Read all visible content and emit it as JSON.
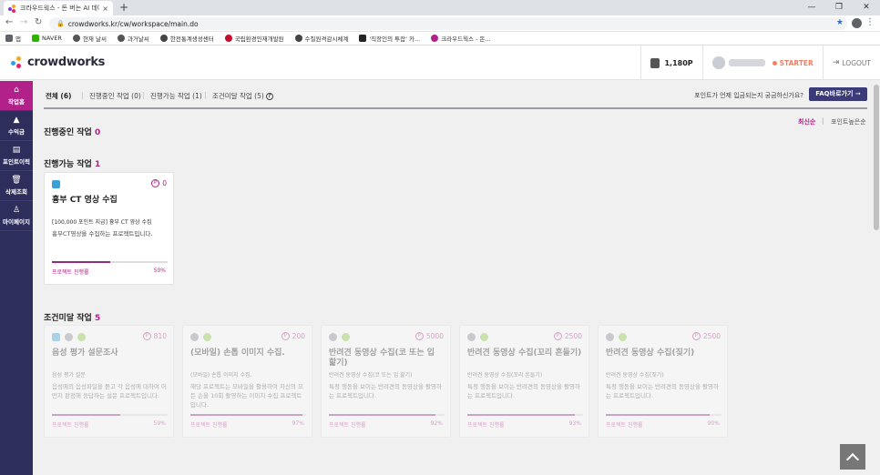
{
  "browser": {
    "tab_title": "크라우드웍스 - 돈 버는 AI 데이터",
    "tab_close": "×",
    "new_tab": "+",
    "url": "crowdworks.kr/cw/workspace/main.do",
    "window_controls": [
      "—",
      "❐",
      "✕"
    ],
    "bookmarks": [
      {
        "label": "앱",
        "icon": "apps-icon",
        "color": "#5f6368"
      },
      {
        "label": "NAVER",
        "icon": "naver-icon",
        "color": "#2db400"
      },
      {
        "label": "현재 날씨",
        "icon": "weather-icon",
        "color": "#555555"
      },
      {
        "label": "과거날씨",
        "icon": "weather-icon",
        "color": "#555555"
      },
      {
        "label": "한전통계생성센터",
        "icon": "globe-icon",
        "color": "#444444"
      },
      {
        "label": "국립환경인재개발원",
        "icon": "korea-icon",
        "color": "#c60c30"
      },
      {
        "label": "수질원격감시체계",
        "icon": "globe-icon",
        "color": "#444444"
      },
      {
        "label": "'직장인의 투잡' 카...",
        "icon": "cafe-icon",
        "color": "#222222"
      },
      {
        "label": "크라우드웍스 - 돈...",
        "icon": "crowdworks-icon",
        "color": "#b2208a"
      }
    ]
  },
  "header": {
    "logo_text": "crowdworks",
    "points": "1,180P",
    "grade": "STARTER",
    "logout": "LOGOUT"
  },
  "sidebar": {
    "items": [
      {
        "label": "작업홈",
        "icon": "home-icon",
        "glyph": "⌂",
        "active": true
      },
      {
        "label": "수익금",
        "icon": "money-icon",
        "glyph": "▲",
        "active": false
      },
      {
        "label": "포인트이력",
        "icon": "history-icon",
        "glyph": "▤",
        "active": false
      },
      {
        "label": "삭제조회",
        "icon": "trash-icon",
        "glyph": "🗑",
        "active": false
      },
      {
        "label": "마이페이지",
        "icon": "user-icon",
        "glyph": "♙",
        "active": false
      }
    ]
  },
  "filters": {
    "all": "전체 (6)",
    "in_progress": "진행중인 작업 (0)",
    "available": "진행가능 작업 (1)",
    "unmet": "조건미달 작업 (5)",
    "help_glyph": "?",
    "faq_question": "포인트가 언제 입금되는지 궁금하신가요?",
    "faq_button": "FAQ바로가기 ➞"
  },
  "sort": {
    "latest": "최신순",
    "sep": "|",
    "points": "포인트높은순"
  },
  "sections": {
    "in_progress": {
      "title": "진행중인 작업",
      "count": "0"
    },
    "available": {
      "title": "진행가능 작업",
      "count": "1"
    },
    "unmet": {
      "title": "조건미달 작업",
      "count": "5"
    }
  },
  "available_cards": [
    {
      "platforms": [
        "mon"
      ],
      "point": "0",
      "title": "흉부 CT 영상 수집",
      "subtitle": "[100,000 포인트 지급] 흉부 CT 영상 수집",
      "desc": "흉부CT영상을 수집하는 프로젝트입니다.",
      "progress_label": "프로젝트 진행률",
      "progress": 50,
      "progress_text": "50%"
    }
  ],
  "unmet_cards": [
    {
      "platforms": [
        "mon",
        "apple",
        "android"
      ],
      "point": "810",
      "title": "음성 평가 설문조사",
      "subtitle": "음성 평가 설문",
      "desc": "음성에의 음성파일을 듣고 각 음성에 대하여 어떤지 판정해 응답하는 설문 프로젝트입니다.",
      "progress_label": "프로젝트 진행률",
      "progress": 59,
      "progress_text": "59%"
    },
    {
      "platforms": [
        "apple",
        "android"
      ],
      "point": "200",
      "title": "(모바일) 손톱 이미지 수집.",
      "subtitle": "(모바일) 손톱 이미지 수집.",
      "desc": "해당 프로젝트는 모바일을 활용하여 자신의 모든 손을 10회 촬영하는 이미지 수집 프로젝트입니다.",
      "progress_label": "프로젝트 진행률",
      "progress": 97,
      "progress_text": "97%"
    },
    {
      "platforms": [
        "apple",
        "android"
      ],
      "point": "5000",
      "title": "반려견 동영상 수집(코 또는 입 핥기)",
      "subtitle": "반려견 동영상 수집(코 또는 입 핥기)",
      "desc": "특정 행동을 보이는 반려견의 동영상을 촬영하는 프로젝트입니다.",
      "progress_label": "프로젝트 진행률",
      "progress": 92,
      "progress_text": "92%"
    },
    {
      "platforms": [
        "apple",
        "android"
      ],
      "point": "2500",
      "title": "반려견 동영상 수집(꼬리 흔들기)",
      "subtitle": "반려견 동영상 수집(꼬리 흔들기)",
      "desc": "특정 행동을 보이는 반려견의 동영상을 촬영하는 프로젝트입니다.",
      "progress_label": "프로젝트 진행률",
      "progress": 93,
      "progress_text": "93%"
    },
    {
      "platforms": [
        "apple",
        "android"
      ],
      "point": "2500",
      "title": "반려견 동영상 수집(짖기)",
      "subtitle": "반려견 동영상 수집(짖기)",
      "desc": "특정 행동을 보이는 반려견의 동영상을 촬영하는 프로젝트입니다.",
      "progress_label": "프로젝트 진행률",
      "progress": 90,
      "progress_text": "90%"
    }
  ],
  "colors": {
    "brand": "#b2208a",
    "sidebar": "#2e2e5c",
    "faq_button": "#3b3b7a",
    "progress": "#8c2d7d"
  }
}
